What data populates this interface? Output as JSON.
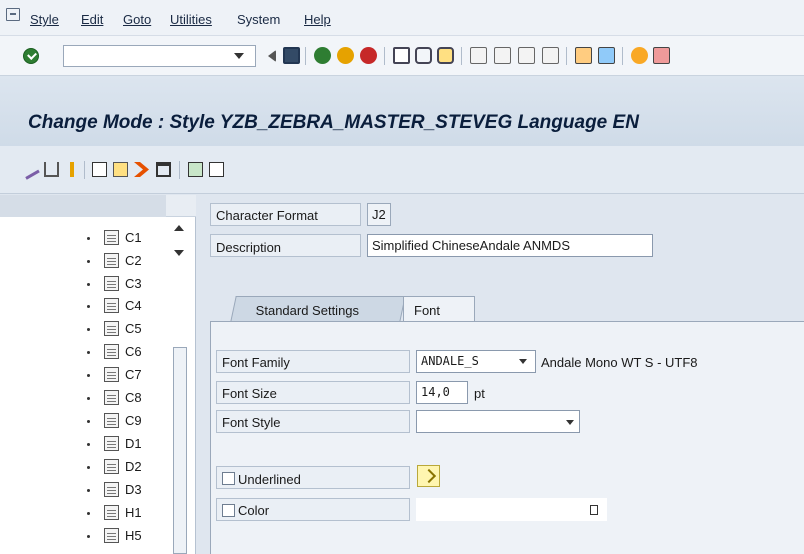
{
  "menu": {
    "items": [
      "Style",
      "Edit",
      "Goto",
      "Utilities",
      "System",
      "Help"
    ]
  },
  "toolbar": {
    "command_value": ""
  },
  "title": "Change Mode : Style YZB_ZEBRA_MASTER_STEVEG Language EN",
  "tree": {
    "items": [
      "C1",
      "C2",
      "C3",
      "C4",
      "C5",
      "C6",
      "C7",
      "C8",
      "C9",
      "D1",
      "D2",
      "D3",
      "H1",
      "H5"
    ]
  },
  "header_fields": {
    "char_format_label": "Character Format",
    "char_format_value": "J2",
    "description_label": "Description",
    "description_value": "Simplified ChineseAndale ANMDS"
  },
  "tabs": {
    "standard": "Standard Settings",
    "font": "Font"
  },
  "font_tab": {
    "family_label": "Font Family",
    "family_value": "ANDALE_S",
    "family_desc": "Andale Mono WT S - UTF8",
    "size_label": "Font Size",
    "size_value": "14,0",
    "size_unit": "pt",
    "style_label": "Font Style",
    "style_value": "",
    "underlined_label": "Underlined",
    "underlined_checked": false,
    "color_label": "Color",
    "color_checked": false,
    "color_value": ""
  }
}
